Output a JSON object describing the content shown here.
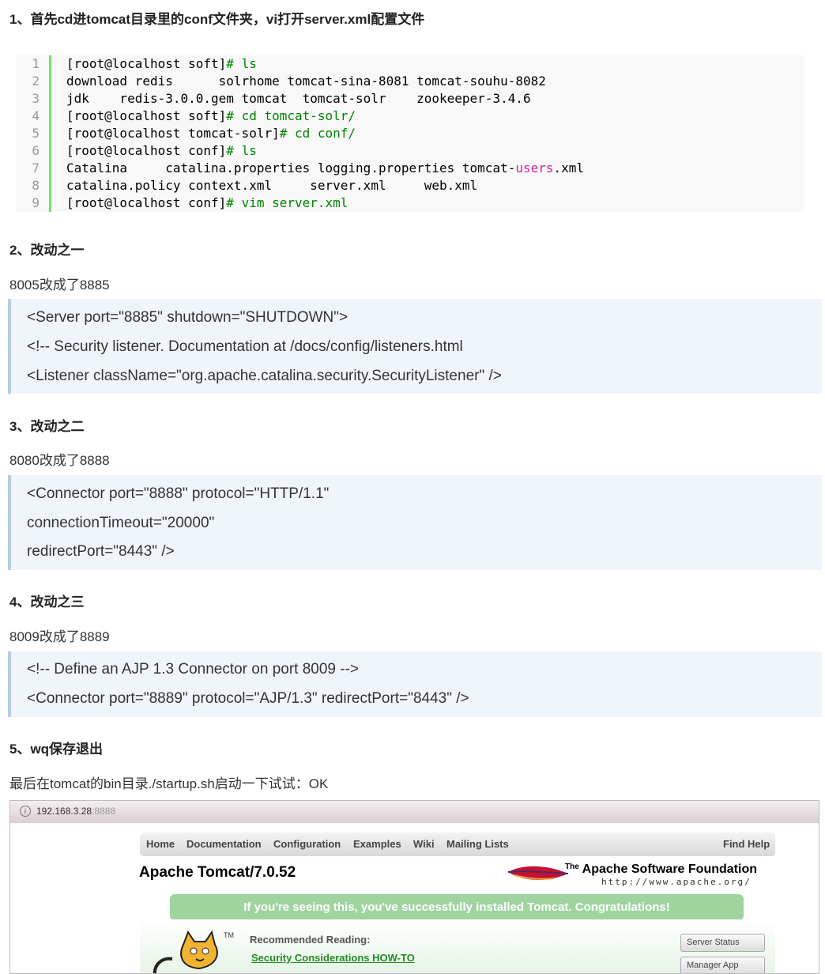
{
  "sections": {
    "s1": "1、首先cd进tomcat目录里的conf文件夹，vi打开server.xml配置文件",
    "s2": "2、改动之一",
    "s2_desc": "8005改成了8885",
    "s3": "3、改动之二",
    "s3_desc": "8080改成了8888",
    "s4": "4、改动之三",
    "s4_desc": "8009改成了8889",
    "s5": "5、wq保存退出",
    "s5_desc": "最后在tomcat的bin目录./startup.sh启动一下试试：OK"
  },
  "code": {
    "line_numbers": [
      "1",
      "2",
      "3",
      "4",
      "5",
      "6",
      "7",
      "8",
      "9"
    ],
    "l1_prompt": "[root@localhost soft]",
    "l1_cmd": "# ls",
    "l2": "download redis      solrhome tomcat-sina-8081 tomcat-souhu-8082",
    "l3": "jdk    redis-3.0.0.gem tomcat  tomcat-solr    zookeeper-3.4.6",
    "l4_prompt": "[root@localhost soft]",
    "l4_cmd": "# cd tomcat-solr/",
    "l5_prompt": "[root@localhost tomcat-solr]",
    "l5_cmd": "# cd conf/",
    "l6_prompt": "[root@localhost conf]",
    "l6_cmd": "# ls",
    "l7_pre": "Catalina     catalina.properties logging.properties tomcat-",
    "l7_kw": "users",
    "l7_post": ".xml",
    "l8": "catalina.policy context.xml     server.xml     web.xml",
    "l9_prompt": "[root@localhost conf]",
    "l9_cmd": "# vim server.xml"
  },
  "quote1": [
    "<Server port=\"8885\" shutdown=\"SHUTDOWN\">",
    "<!-- Security listener. Documentation at /docs/config/listeners.html",
    "<Listener className=\"org.apache.catalina.security.SecurityListener\" />"
  ],
  "quote2": [
    "<Connector port=\"8888\" protocol=\"HTTP/1.1\"",
    "connectionTimeout=\"20000\"",
    "redirectPort=\"8443\" />"
  ],
  "quote3": [
    "<!-- Define an AJP 1.3 Connector on port 8009 -->",
    "<Connector port=\"8889\" protocol=\"AJP/1.3\" redirectPort=\"8443\" />"
  ],
  "screenshot": {
    "info_icon": "i",
    "url_host": "192.168.3.28",
    "url_port": ":8888",
    "nav": [
      "Home",
      "Documentation",
      "Configuration",
      "Examples",
      "Wiki",
      "Mailing Lists"
    ],
    "find_help": "Find Help",
    "title": "Apache Tomcat/7.0.52",
    "asf_the": "The",
    "asf_name": "Apache Software Foundation",
    "asf_url": "http://www.apache.org/",
    "banner": "If you're seeing this, you've successfully installed Tomcat. Congratulations!",
    "tm": "TM",
    "recommended": "Recommended Reading:",
    "link1": "Security Considerations HOW-TO",
    "btn1": "Server Status",
    "btn2": "Manager App"
  },
  "colors": {
    "prompt_cmd": "#008200",
    "keyword": "#d12098",
    "gutter_bar": "#6ce26c",
    "quote_bg": "#f0f5fb",
    "quote_border": "#b9cbe0"
  }
}
